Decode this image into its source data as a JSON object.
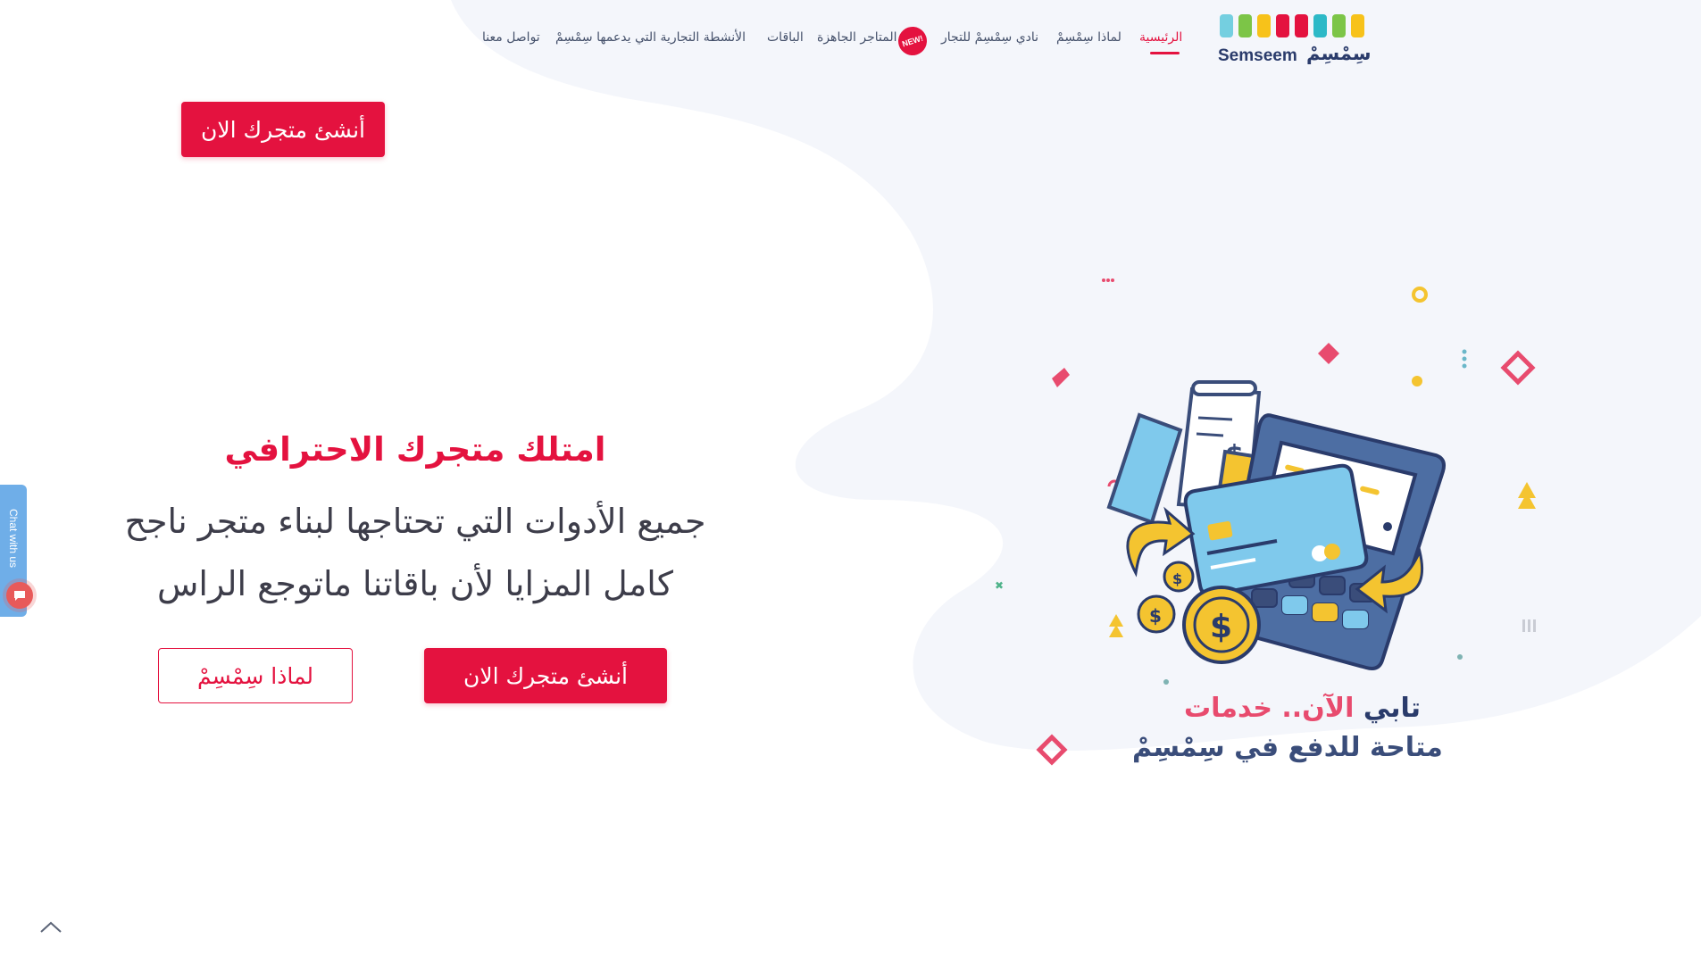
{
  "colors": {
    "brand_red": "#e4123f",
    "text_dark": "#3d3d4a",
    "nav_text": "#44506a",
    "blob_bg": "#f4f6fb",
    "chat_blue": "#6faee8"
  },
  "logo": {
    "name_en": "Semseem",
    "name_ar": "سِمْسِمْ",
    "bag_colors": [
      "#74cfe0",
      "#7cc547",
      "#f7c21a",
      "#e4123f",
      "#e4123f",
      "#2db9c7",
      "#7cc547",
      "#f7c21a"
    ]
  },
  "nav": {
    "items": [
      {
        "label": "الرئيسية",
        "active": true
      },
      {
        "label": "لماذا سِمْسِمْ",
        "active": false
      },
      {
        "label": "نادي سِمْسِمْ للتجار",
        "active": false
      },
      {
        "label": "المتاجر الجاهزة",
        "active": false
      },
      {
        "label": "الباقات",
        "active": false
      },
      {
        "label": "الأنشطة التجارية التي يدعمها سِمْسِمْ",
        "active": false
      },
      {
        "label": "تواصل معنا",
        "active": false
      }
    ],
    "new_badge": "NEW!"
  },
  "top_cta": {
    "label": "أنشئ متجرك الان"
  },
  "hero": {
    "title": "امتلك متجرك الاحترافي",
    "line1": "جميع الأدوات التي تحتاجها لبناء متجر ناجح",
    "line2": "كامل المزايا لأن باقاتنا ماتوجع الراس",
    "primary_cta": "أنشئ متجرك الان",
    "secondary_cta": "لماذا سِمْسِمْ"
  },
  "promo": {
    "line1_prefix": "الآن.. خدمات",
    "line1_brand": "تابي",
    "line2": "متاحة للدفع في سِمْسِمْ"
  },
  "chat_widget": {
    "label": "Chat with us",
    "icon": "chat-bubble-icon"
  },
  "scroll_top": {
    "icon": "chevron-up-icon"
  }
}
